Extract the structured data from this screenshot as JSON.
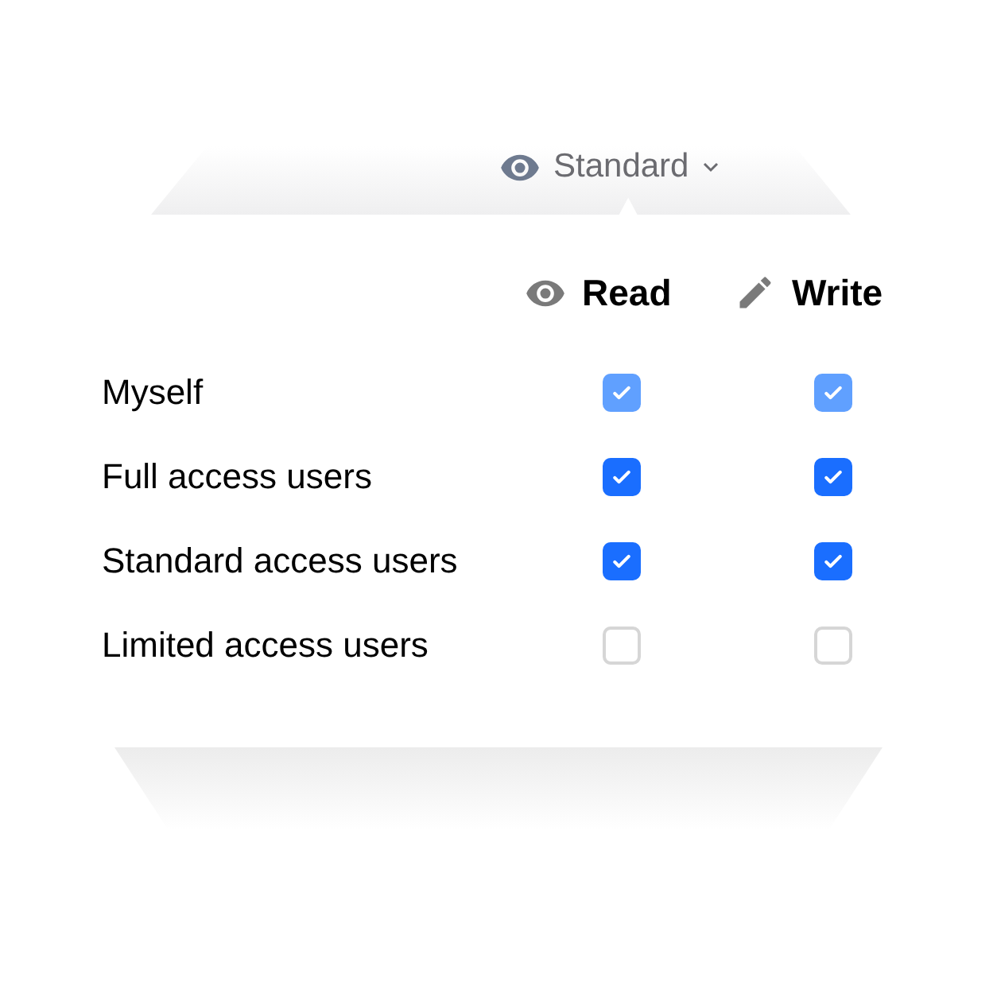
{
  "dropdown": {
    "label": "Standard"
  },
  "columns": [
    {
      "kind": "read",
      "label": "Read"
    },
    {
      "kind": "write",
      "label": "Write"
    }
  ],
  "rows": [
    {
      "label": "Myself",
      "read": true,
      "write": true,
      "disabled": true
    },
    {
      "label": "Full access users",
      "read": true,
      "write": true,
      "disabled": false
    },
    {
      "label": "Standard access users",
      "read": true,
      "write": true,
      "disabled": false
    },
    {
      "label": "Limited access users",
      "read": false,
      "write": false,
      "disabled": false
    }
  ]
}
